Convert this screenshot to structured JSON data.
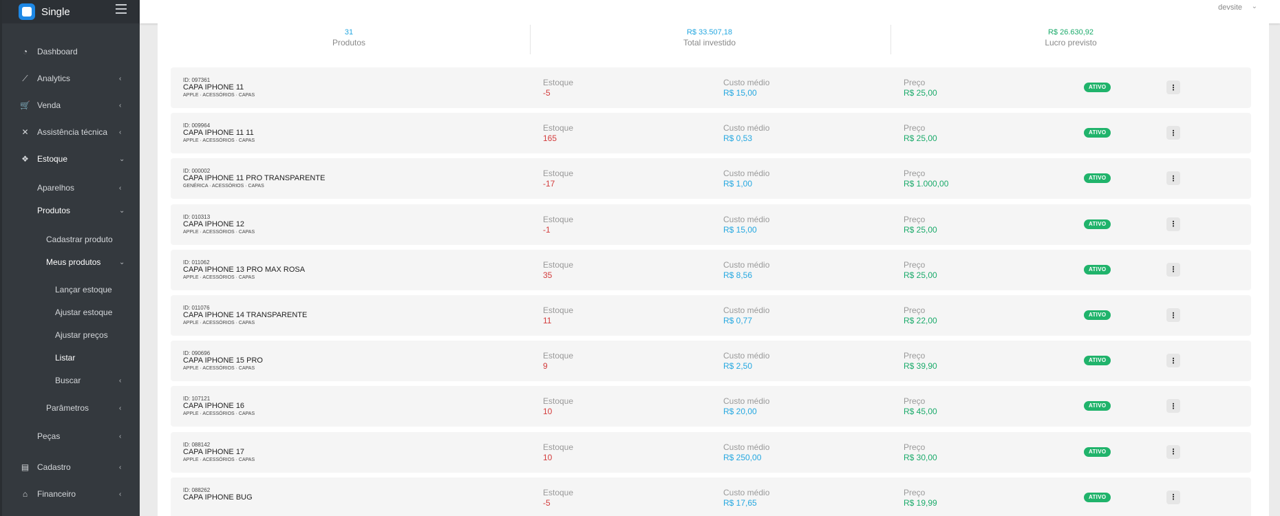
{
  "app": {
    "name": "Single"
  },
  "user": {
    "name": "devsite"
  },
  "sidebar": {
    "items": [
      {
        "label": "Dashboard",
        "icon": "dashboard-icon",
        "glyph": "◔",
        "chev": ""
      },
      {
        "label": "Analytics",
        "icon": "chart-line-icon",
        "glyph": "⟋",
        "chev": "‹"
      },
      {
        "label": "Venda",
        "icon": "cart-icon",
        "glyph": "🛒",
        "chev": "‹"
      },
      {
        "label": "Assistência técnica",
        "icon": "tools-icon",
        "glyph": "✕",
        "chev": "‹"
      },
      {
        "label": "Estoque",
        "icon": "boxes-icon",
        "glyph": "❖",
        "chev": "⌄"
      }
    ],
    "estoque_sub": [
      {
        "label": "Aparelhos",
        "chev": "‹"
      },
      {
        "label": "Produtos",
        "chev": "⌄"
      }
    ],
    "produtos_sub": [
      {
        "label": "Cadastrar produto",
        "chev": ""
      },
      {
        "label": "Meus produtos",
        "chev": "⌄"
      }
    ],
    "meus_sub": [
      {
        "label": "Lançar estoque",
        "chev": ""
      },
      {
        "label": "Ajustar estoque",
        "chev": ""
      },
      {
        "label": "Ajustar preços",
        "chev": ""
      },
      {
        "label": "Listar",
        "chev": ""
      },
      {
        "label": "Buscar",
        "chev": "‹"
      }
    ],
    "parametros": {
      "label": "Parâmetros",
      "chev": "‹"
    },
    "pecas": {
      "label": "Peças",
      "chev": "‹"
    },
    "bottom": [
      {
        "label": "Cadastro",
        "icon": "id-card-icon",
        "glyph": "▤",
        "chev": "‹"
      },
      {
        "label": "Financeiro",
        "icon": "bank-icon",
        "glyph": "⌂",
        "chev": "‹"
      }
    ]
  },
  "stats": [
    {
      "value": "31",
      "label": "Produtos",
      "color": "#24a7e0"
    },
    {
      "value": "R$ 33.507,18",
      "label": "Total investido",
      "color": "#24a7e0"
    },
    {
      "value": "R$ 26.630,92",
      "label": "Lucro previsto",
      "color": "#1aaa6a"
    }
  ],
  "labels": {
    "estoque": "Estoque",
    "custo": "Custo médio",
    "preco": "Preço",
    "status": "ATIVO"
  },
  "products": [
    {
      "id": "ID: 097361",
      "name": "CAPA IPHONE 11",
      "cat": "APPLE · ACESSÓRIOS · CAPAS",
      "estoque": "-5",
      "custo": "R$ 15,00",
      "preco": "R$ 25,00"
    },
    {
      "id": "ID: 009964",
      "name": "CAPA IPHONE 11 11",
      "cat": "APPLE · ACESSÓRIOS · CAPAS",
      "estoque": "165",
      "custo": "R$ 0,53",
      "preco": "R$ 25,00"
    },
    {
      "id": "ID: 000002",
      "name": "CAPA IPHONE 11 PRO TRANSPARENTE",
      "cat": "GENÉRICA · ACESSÓRIOS · CAPAS",
      "estoque": "-17",
      "custo": "R$ 1,00",
      "preco": "R$ 1.000,00"
    },
    {
      "id": "ID: 010313",
      "name": "CAPA IPHONE 12",
      "cat": "APPLE · ACESSÓRIOS · CAPAS",
      "estoque": "-1",
      "custo": "R$ 15,00",
      "preco": "R$ 25,00"
    },
    {
      "id": "ID: 011062",
      "name": "CAPA IPHONE 13 PRO MAX ROSA",
      "cat": "APPLE · ACESSÓRIOS · CAPAS",
      "estoque": "35",
      "custo": "R$ 8,56",
      "preco": "R$ 25,00"
    },
    {
      "id": "ID: 011076",
      "name": "CAPA IPHONE 14 TRANSPARENTE",
      "cat": "APPLE · ACESSÓRIOS · CAPAS",
      "estoque": "11",
      "custo": "R$ 0,77",
      "preco": "R$ 22,00"
    },
    {
      "id": "ID: 090696",
      "name": "CAPA IPHONE 15 PRO",
      "cat": "APPLE · ACESSÓRIOS · CAPAS",
      "estoque": "9",
      "custo": "R$ 2,50",
      "preco": "R$ 39,90"
    },
    {
      "id": "ID: 107121",
      "name": "CAPA IPHONE 16",
      "cat": "APPLE · ACESSÓRIOS · CAPAS",
      "estoque": "10",
      "custo": "R$ 20,00",
      "preco": "R$ 45,00"
    },
    {
      "id": "ID: 088142",
      "name": "CAPA IPHONE 17",
      "cat": "APPLE · ACESSÓRIOS · CAPAS",
      "estoque": "10",
      "custo": "R$ 250,00",
      "preco": "R$ 30,00"
    },
    {
      "id": "ID: 088262",
      "name": "CAPA IPHONE BUG",
      "cat": "",
      "estoque": "-5",
      "custo": "R$ 17,65",
      "preco": "R$ 19,99"
    }
  ]
}
